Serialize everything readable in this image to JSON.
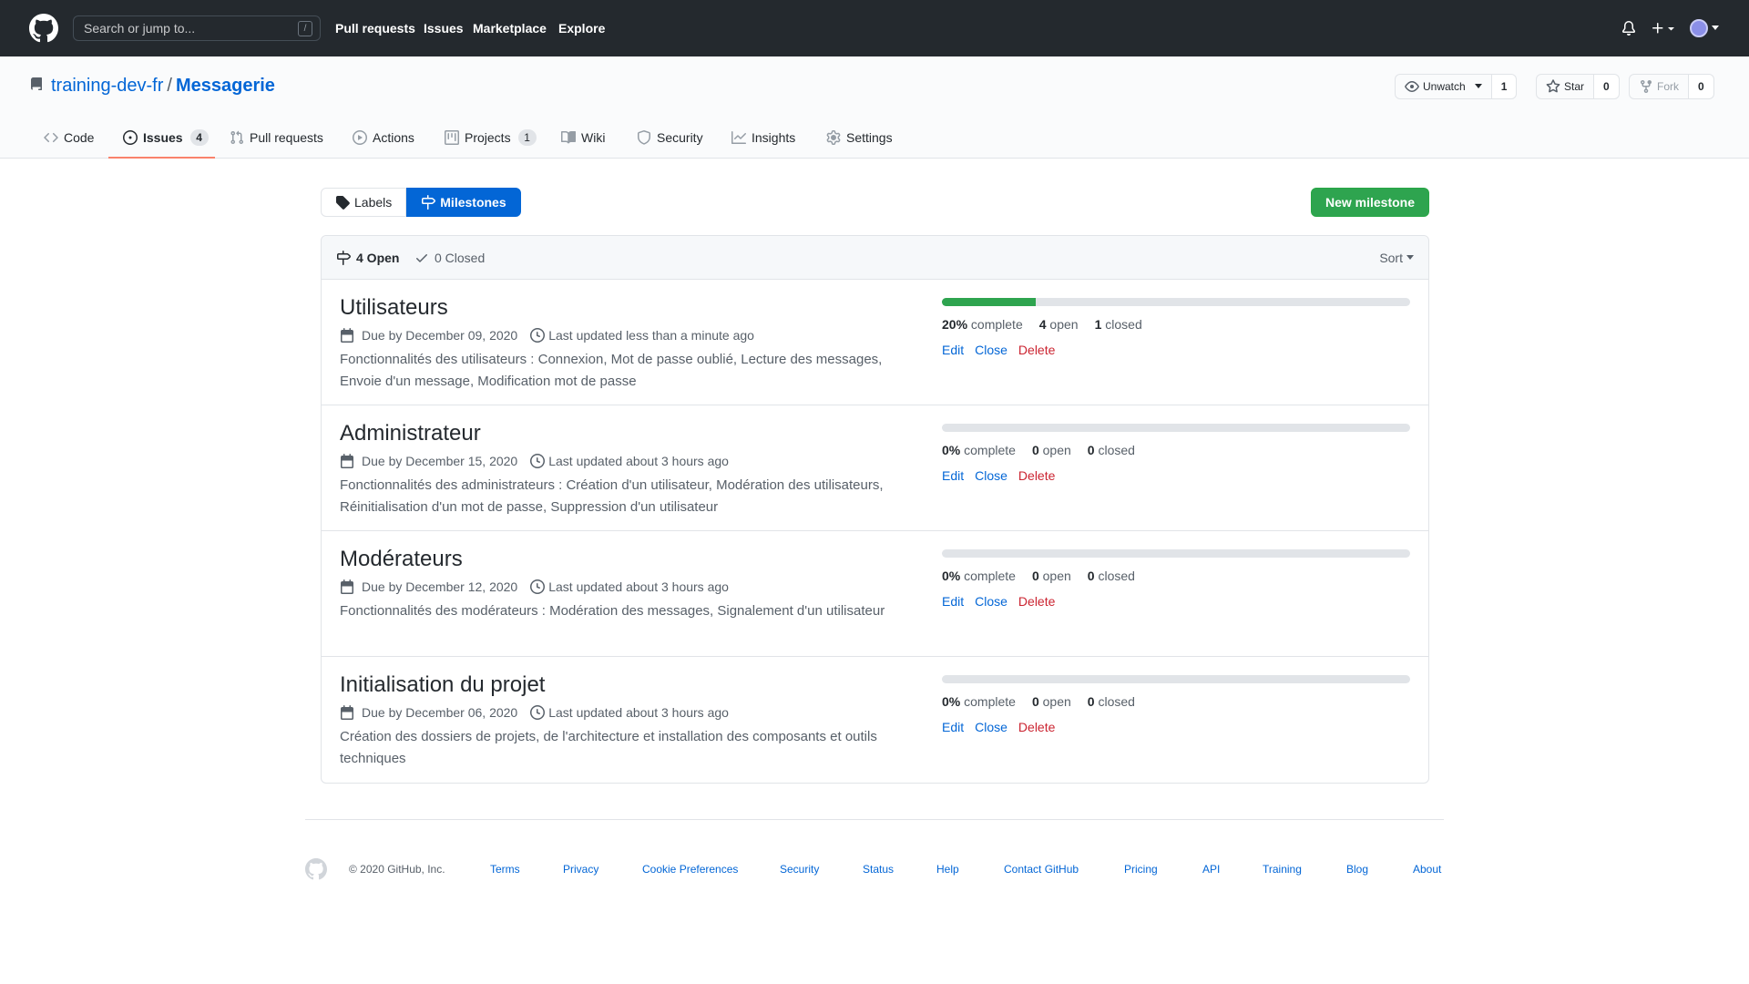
{
  "header": {
    "search_placeholder": "Search or jump to...",
    "slash_key": "/",
    "nav": [
      "Pull requests",
      "Issues",
      "Marketplace",
      "Explore"
    ]
  },
  "repo": {
    "owner": "training-dev-fr",
    "separator": "/",
    "name": "Messagerie",
    "watch": {
      "label": "Unwatch",
      "count": "1"
    },
    "star": {
      "label": "Star",
      "count": "0"
    },
    "fork": {
      "label": "Fork",
      "count": "0"
    },
    "tabs": [
      {
        "label": "Code",
        "icon": "code-icon"
      },
      {
        "label": "Issues",
        "icon": "issue-icon",
        "counter": "4",
        "selected": true
      },
      {
        "label": "Pull requests",
        "icon": "pull-request-icon"
      },
      {
        "label": "Actions",
        "icon": "play-icon"
      },
      {
        "label": "Projects",
        "icon": "project-icon",
        "counter": "1"
      },
      {
        "label": "Wiki",
        "icon": "book-icon"
      },
      {
        "label": "Security",
        "icon": "shield-icon"
      },
      {
        "label": "Insights",
        "icon": "graph-icon"
      },
      {
        "label": "Settings",
        "icon": "gear-icon"
      }
    ]
  },
  "subnav": {
    "labels": "Labels",
    "milestones": "Milestones",
    "new_milestone": "New milestone"
  },
  "milestones_box": {
    "open_label": "4 Open",
    "closed_label": "0 Closed",
    "sort_label": "Sort",
    "items": [
      {
        "title": "Utilisateurs",
        "due": "Due by December 09, 2020",
        "updated": "Last updated less than a minute ago",
        "description": "Fonctionnalités des utilisateurs : Connexion, Mot de passe oublié, Lecture des messages, Envoie d'un message, Modification mot de passe",
        "percent": "20%",
        "percent_value": 20,
        "complete_label": "complete",
        "open_count": "4",
        "open_label": "open",
        "closed_count": "1",
        "closed_label": "closed"
      },
      {
        "title": "Administrateur",
        "due": "Due by December 15, 2020",
        "updated": "Last updated about 3 hours ago",
        "description": "Fonctionnalités des administrateurs : Création d'un utilisateur, Modération des utilisateurs, Réinitialisation d'un mot de passe, Suppression d'un utilisateur",
        "percent": "0%",
        "percent_value": 0,
        "complete_label": "complete",
        "open_count": "0",
        "open_label": "open",
        "closed_count": "0",
        "closed_label": "closed"
      },
      {
        "title": "Modérateurs",
        "due": "Due by December 12, 2020",
        "updated": "Last updated about 3 hours ago",
        "description": "Fonctionnalités des modérateurs : Modération des messages, Signalement d'un utilisateur",
        "percent": "0%",
        "percent_value": 0,
        "complete_label": "complete",
        "open_count": "0",
        "open_label": "open",
        "closed_count": "0",
        "closed_label": "closed"
      },
      {
        "title": "Initialisation du projet",
        "due": "Due by December 06, 2020",
        "updated": "Last updated about 3 hours ago",
        "description": "Création des dossiers de projets, de l'architecture et installation des composants et outils techniques",
        "percent": "0%",
        "percent_value": 0,
        "complete_label": "complete",
        "open_count": "0",
        "open_label": "open",
        "closed_count": "0",
        "closed_label": "closed"
      }
    ],
    "actions": {
      "edit": "Edit",
      "close": "Close",
      "delete": "Delete"
    }
  },
  "footer": {
    "copyright": "© 2020 GitHub, Inc.",
    "links": [
      "Terms",
      "Privacy",
      "Cookie Preferences",
      "Security",
      "Status",
      "Help",
      "Contact GitHub",
      "Pricing",
      "API",
      "Training",
      "Blog",
      "About"
    ]
  },
  "colors": {
    "header_bg": "#24292e",
    "link_blue": "#0366d6",
    "primary_green": "#2ea44f",
    "danger_red": "#cb2431",
    "tab_underline": "#f9826c"
  }
}
